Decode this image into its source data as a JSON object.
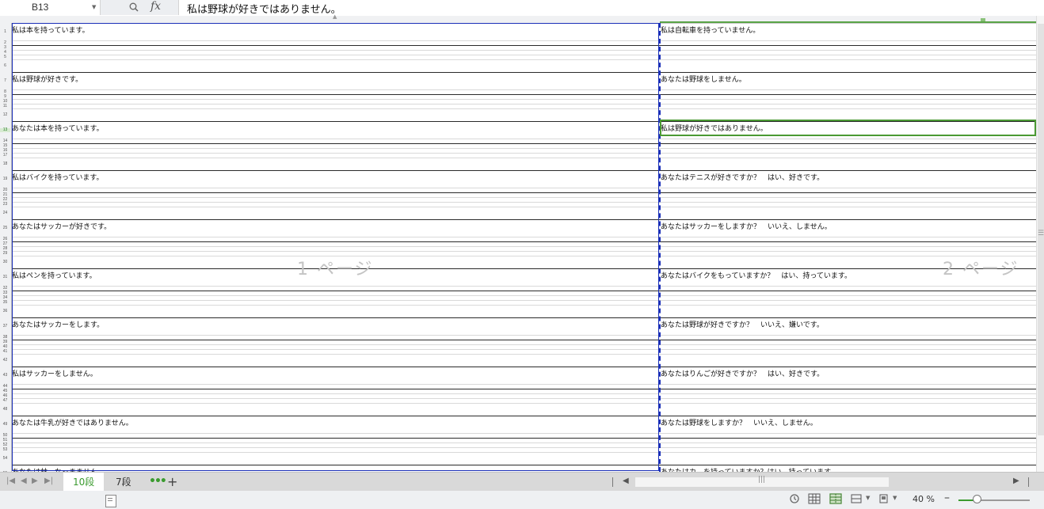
{
  "formula_bar": {
    "cell_ref": "B13",
    "fx": "fx",
    "content": "私は野球が好きではありません。"
  },
  "rows": [
    {
      "num": "1",
      "a": "私は本を持っています。",
      "b": "私は自転車を持っていません。"
    },
    {
      "num": "7",
      "a": "私は野球が好きです。",
      "b": "あなたは野球をしません。"
    },
    {
      "num": "13",
      "a": "あなたは本を持っています。",
      "b": "私は野球が好きではありません。"
    },
    {
      "num": "19",
      "a": "私はバイクを持っています。",
      "b": "あなたはテニスが好きですか？　はい、好きです。"
    },
    {
      "num": "25",
      "a": "あなたはサッカーが好きです。",
      "b": "あなたはサッカーをしますか？　いいえ、しません。"
    },
    {
      "num": "31",
      "a": "私はペンを持っています。",
      "b": "あなたはバイクをもっていますか？　はい、持っています。"
    },
    {
      "num": "37",
      "a": "あなたはサッカーをします。",
      "b": "あなたは野球が好きですか？　いいえ、嫌いです。"
    },
    {
      "num": "43",
      "a": "私はサッカーをしません。",
      "b": "あなたはりんごが好きですか？　はい、好きです。"
    },
    {
      "num": "49",
      "a": "あなたは牛乳が好きではありません。",
      "b": "あなたは野球をしますか？　いいえ、しません。"
    },
    {
      "num": "55",
      "a": "あなたは林　なっまません",
      "b": "あなたはカ　を持っていますか？はい、持っています"
    }
  ],
  "page_labels": [
    "1 ページ",
    "2 ページ"
  ],
  "selected_row": "13",
  "sheet_tabs": [
    {
      "label": "10段",
      "active": true
    },
    {
      "label": "7段",
      "active": false
    }
  ],
  "tab_more": "•••",
  "tab_add": "+",
  "scroll_grip": "|||",
  "zoom": "40 %",
  "colors": {
    "accent": "#3b9b2f",
    "page_border": "#1a2fb8",
    "selection": "#4b9a33"
  },
  "icons": [
    "zoom-icon",
    "fx-icon",
    "nav-first-icon",
    "nav-prev-icon",
    "nav-next-icon",
    "nav-last-icon",
    "scroll-left-icon",
    "scroll-right-icon",
    "record-macro-icon",
    "history-icon",
    "normal-view-icon",
    "page-break-view-icon",
    "page-layout-icon",
    "reading-mode-icon"
  ]
}
